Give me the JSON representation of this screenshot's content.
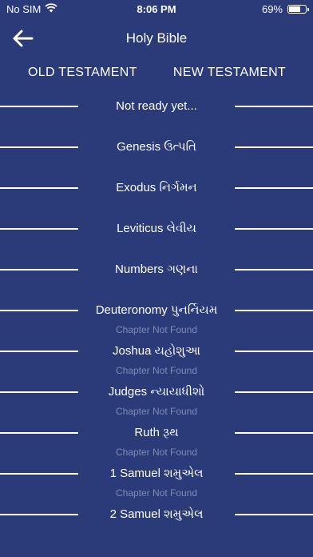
{
  "status": {
    "carrier": "No SIM",
    "time": "8:06 PM",
    "battery_percent": "69%",
    "battery_level": 0.69
  },
  "nav": {
    "title": "Holy Bible",
    "back_icon": "arrow-left-icon"
  },
  "tabs": {
    "old": "OLD TESTAMENT",
    "new": "NEW TESTAMENT"
  },
  "books": [
    {
      "name": "Not ready yet...",
      "sub": ""
    },
    {
      "name": "Genesis ઉત્પતિ",
      "sub": ""
    },
    {
      "name": "Exodus નિર્ગમન",
      "sub": ""
    },
    {
      "name": "Leviticus લેવીય",
      "sub": ""
    },
    {
      "name": "Numbers ગણના",
      "sub": ""
    },
    {
      "name": "Deuteronomy પુનર્નિયમ",
      "sub": "Chapter Not Found"
    },
    {
      "name": "Joshua યહોશુઆ",
      "sub": "Chapter Not Found"
    },
    {
      "name": "Judges  ન્યાયાધીશો",
      "sub": "Chapter Not Found"
    },
    {
      "name": "Ruth રૂથ",
      "sub": "Chapter Not Found"
    },
    {
      "name": "1 Samuel  શમુએલ",
      "sub": "Chapter Not Found"
    },
    {
      "name": "2 Samuel શમુએલ",
      "sub": ""
    }
  ],
  "colors": {
    "background": "#2b3a78",
    "text": "#ffffff",
    "muted": "#7f8bb8"
  }
}
